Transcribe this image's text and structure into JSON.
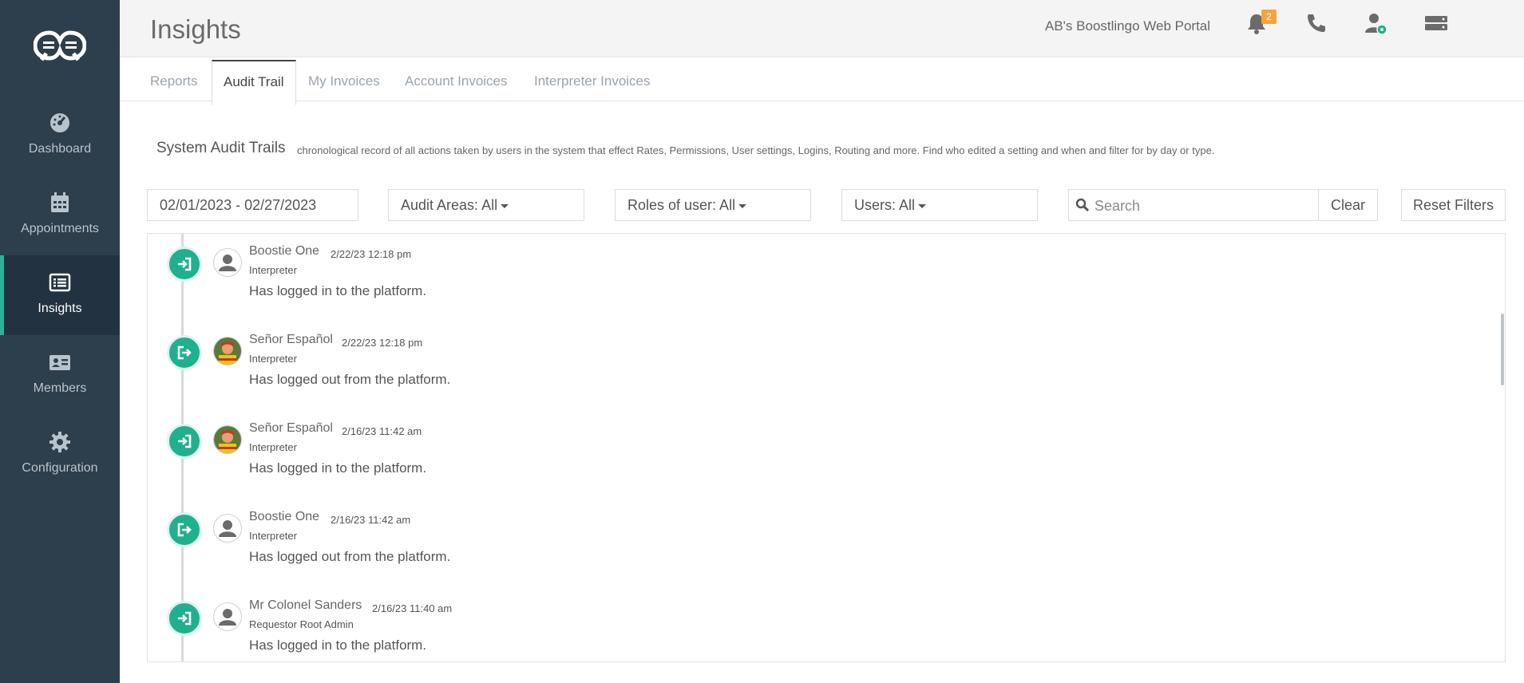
{
  "sidebar": {
    "items": [
      {
        "label": "Dashboard",
        "icon": "dashboard-icon"
      },
      {
        "label": "Appointments",
        "icon": "calendar-icon"
      },
      {
        "label": "Insights",
        "icon": "list-icon"
      },
      {
        "label": "Members",
        "icon": "id-card-icon"
      },
      {
        "label": "Configuration",
        "icon": "gear-icon"
      }
    ],
    "active": "Insights"
  },
  "header": {
    "title": "Insights",
    "portal_name": "AB's Boostlingo Web Portal",
    "notification_count": "2"
  },
  "tabs": [
    {
      "label": "Reports"
    },
    {
      "label": "Audit Trail"
    },
    {
      "label": "My Invoices"
    },
    {
      "label": "Account Invoices"
    },
    {
      "label": "Interpreter Invoices"
    }
  ],
  "active_tab": "Audit Trail",
  "section": {
    "title": "System Audit Trails",
    "description": "chronological record of all actions taken by users in the system that effect Rates, Permissions, User settings, Logins, Routing and more. Find who edited a setting and when and filter for by day or type."
  },
  "filters": {
    "date_range": "02/01/2023 - 02/27/2023",
    "audit_areas": "Audit Areas: All",
    "roles": "Roles of user: All",
    "users": "Users: All",
    "search_placeholder": "Search",
    "clear_label": "Clear",
    "reset_label": "Reset Filters"
  },
  "entries": [
    {
      "name": "Boostie One",
      "timestamp": "2/22/23 12:18 pm",
      "role": "Interpreter",
      "message": "Has logged in to the platform.",
      "action": "login",
      "avatar": "default"
    },
    {
      "name": "Señor Español",
      "timestamp": "2/22/23 12:18 pm",
      "role": "Interpreter",
      "message": "Has logged out from the platform.",
      "action": "logout",
      "avatar": "photo"
    },
    {
      "name": "Señor Español",
      "timestamp": "2/16/23 11:42 am",
      "role": "Interpreter",
      "message": "Has logged in to the platform.",
      "action": "login",
      "avatar": "photo"
    },
    {
      "name": "Boostie One",
      "timestamp": "2/16/23 11:42 am",
      "role": "Interpreter",
      "message": "Has logged out from the platform.",
      "action": "logout",
      "avatar": "default"
    },
    {
      "name": "Mr Colonel Sanders",
      "timestamp": "2/16/23 11:40 am",
      "role": "Requestor Root Admin",
      "message": "Has logged in to the platform.",
      "action": "login",
      "avatar": "default"
    }
  ],
  "colors": {
    "sidebar_bg": "#2d3e4c",
    "accent": "#21b08d",
    "badge": "#f5a33b"
  }
}
